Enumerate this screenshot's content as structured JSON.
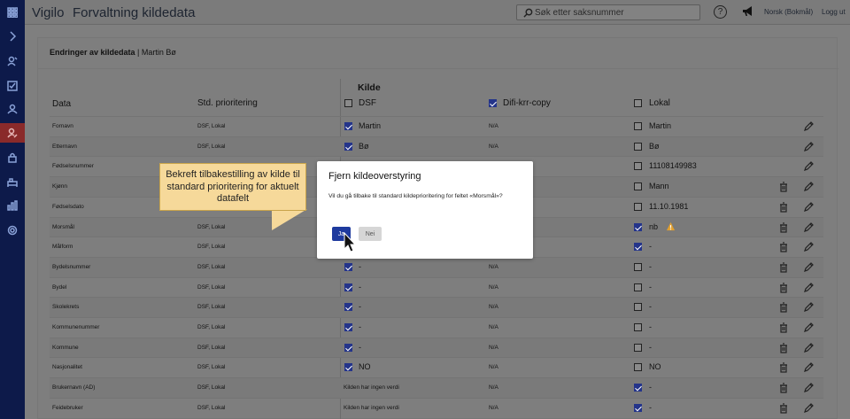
{
  "header": {
    "brand": "Vigilo",
    "app_title": "Forvaltning kildedata",
    "search_placeholder": "Søk etter saksnummer",
    "help_label": "?",
    "language": "Norsk (Bokmål)",
    "logout": "Logg ut"
  },
  "sidebar": {
    "items": [
      "apps-icon",
      "chevron-right-icon",
      "person-key-icon",
      "checklist-icon",
      "person-icon",
      "person-edit-icon",
      "lock-icon",
      "bed-icon",
      "bar-chart-icon",
      "gear-icon"
    ],
    "active_index": 5
  },
  "card": {
    "title_bold": "Endringer av kildedata",
    "title_rest": "| Martin Bø"
  },
  "table": {
    "kilde_header": "Kilde",
    "columns": {
      "data": "Data",
      "std": "Std. prioritering",
      "dsf": "DSF",
      "difi": "Difi-krr-copy",
      "lokal": "Lokal"
    },
    "rows": [
      {
        "data": "Fornavn",
        "std": "DSF, Lokal",
        "dsf_checked": true,
        "dsf_val": "Martin",
        "difi": "N/A",
        "lokal_checked": false,
        "lokal_val": "Martin",
        "trash": false,
        "warn": false
      },
      {
        "data": "Etternavn",
        "std": "DSF, Lokal",
        "dsf_checked": true,
        "dsf_val": "Bø",
        "difi": "N/A",
        "lokal_checked": false,
        "lokal_val": "Bø",
        "trash": false,
        "warn": false
      },
      {
        "data": "Fødselsnummer",
        "std": "",
        "dsf_checked": null,
        "dsf_val": "",
        "difi": "",
        "lokal_checked": false,
        "lokal_val": "11108149983",
        "trash": false,
        "warn": false
      },
      {
        "data": "Kjønn",
        "std": "",
        "dsf_checked": null,
        "dsf_val": "",
        "difi": "",
        "lokal_checked": false,
        "lokal_val": "Mann",
        "trash": true,
        "warn": false
      },
      {
        "data": "Fødselsdato",
        "std": "",
        "dsf_checked": null,
        "dsf_val": "",
        "difi": "",
        "lokal_checked": false,
        "lokal_val": "11.10.1981",
        "trash": true,
        "warn": false
      },
      {
        "data": "Morsmål",
        "std": "DSF, Lokal",
        "dsf_checked": null,
        "dsf_val": "",
        "difi": "",
        "lokal_checked": true,
        "lokal_val": "nb",
        "trash": true,
        "warn": true
      },
      {
        "data": "Målform",
        "std": "DSF, Lokal",
        "dsf_checked": null,
        "dsf_val": "",
        "difi": "",
        "lokal_checked": true,
        "lokal_val": "-",
        "trash": true,
        "warn": false
      },
      {
        "data": "Bydelsnummer",
        "std": "DSF, Lokal",
        "dsf_checked": true,
        "dsf_val": "-",
        "difi": "N/A",
        "lokal_checked": false,
        "lokal_val": "-",
        "trash": true,
        "warn": false
      },
      {
        "data": "Bydel",
        "std": "DSF, Lokal",
        "dsf_checked": true,
        "dsf_val": "-",
        "difi": "N/A",
        "lokal_checked": false,
        "lokal_val": "-",
        "trash": true,
        "warn": false
      },
      {
        "data": "Skolekrets",
        "std": "DSF, Lokal",
        "dsf_checked": true,
        "dsf_val": "-",
        "difi": "N/A",
        "lokal_checked": false,
        "lokal_val": "-",
        "trash": true,
        "warn": false
      },
      {
        "data": "Kommunenummer",
        "std": "DSF, Lokal",
        "dsf_checked": true,
        "dsf_val": "-",
        "difi": "N/A",
        "lokal_checked": false,
        "lokal_val": "-",
        "trash": true,
        "warn": false
      },
      {
        "data": "Kommune",
        "std": "DSF, Lokal",
        "dsf_checked": true,
        "dsf_val": "-",
        "difi": "N/A",
        "lokal_checked": false,
        "lokal_val": "-",
        "trash": true,
        "warn": false
      },
      {
        "data": "Nasjonalitet",
        "std": "DSF, Lokal",
        "dsf_checked": true,
        "dsf_val": "NO",
        "difi": "N/A",
        "lokal_checked": false,
        "lokal_val": "NO",
        "trash": true,
        "warn": false
      },
      {
        "data": "Brukernavn (AD)",
        "std": "DSF, Lokal",
        "dsf_checked": null,
        "dsf_val": "Kilden har ingen verdi",
        "difi": "N/A",
        "lokal_checked": true,
        "lokal_val": "-",
        "trash": true,
        "warn": false
      },
      {
        "data": "Feidebruker",
        "std": "DSF, Lokal",
        "dsf_checked": null,
        "dsf_val": "Kilden har ingen verdi",
        "difi": "N/A",
        "lokal_checked": true,
        "lokal_val": "-",
        "trash": true,
        "warn": false
      }
    ]
  },
  "callout": {
    "text": "Bekreft tilbakestilling av kilde til standard prioritering for aktuelt datafelt"
  },
  "modal": {
    "title": "Fjern kildeoverstyring",
    "body": "Vil du gå tilbake til standard kildeprioritering for feltet «Morsmål»?",
    "yes": "Ja",
    "no": "Nei"
  },
  "colors": {
    "sidebar": "#0d1a4a",
    "sidebar_active": "#8a2a2a",
    "primary_button": "#1e3a9e",
    "callout": "#f6d99a",
    "warning": "#e0a030"
  }
}
